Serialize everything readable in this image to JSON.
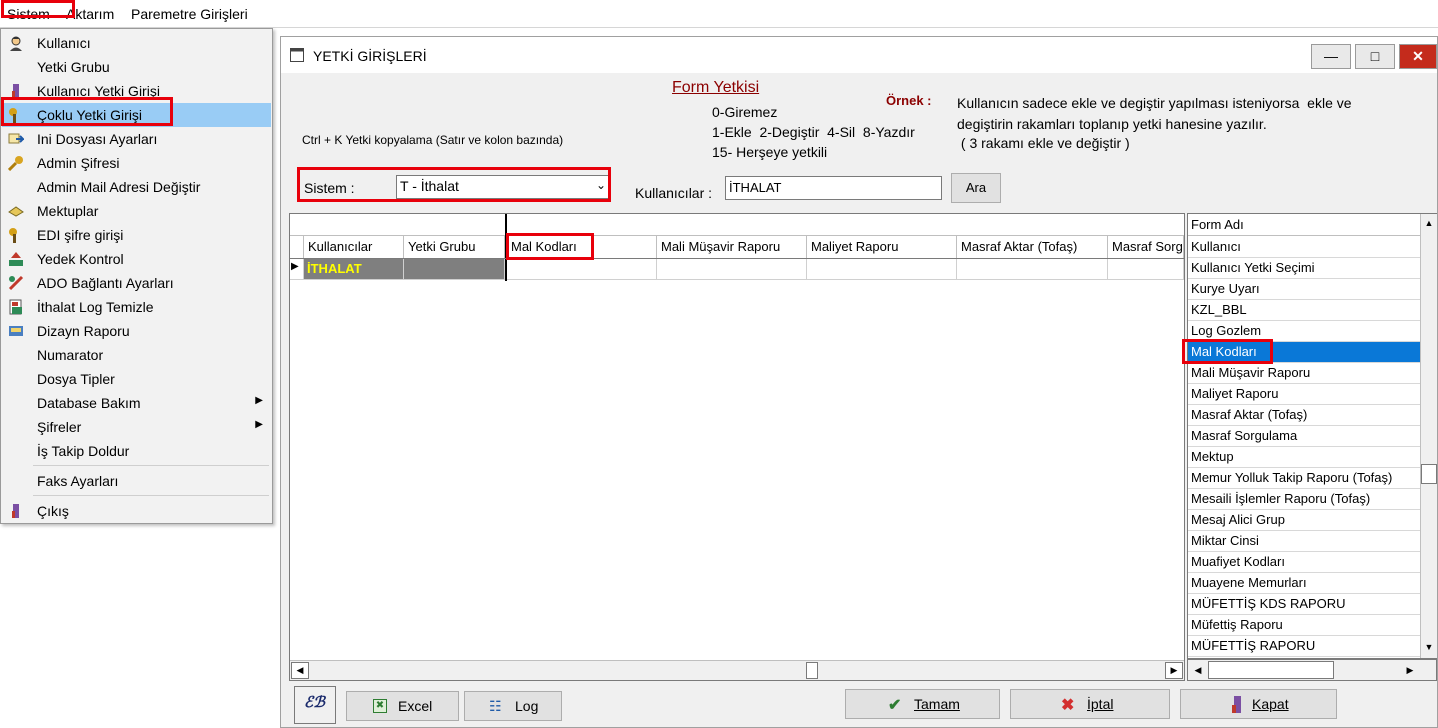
{
  "menubar": {
    "items": [
      "Sistem",
      "Aktarım",
      "Paremetre Girişleri"
    ]
  },
  "dropdown": {
    "items": [
      {
        "label": "Kullanıcı",
        "icon": "user-icon"
      },
      {
        "label": "Yetki Grubu",
        "icon": ""
      },
      {
        "label": "Kullanıcı Yetki Girişi",
        "icon": "user-key-icon"
      },
      {
        "label": "Çoklu Yetki Girişi",
        "icon": "multi-key-icon"
      },
      {
        "label": "Ini Dosyası  Ayarları",
        "icon": "ini-settings-icon"
      },
      {
        "label": "Admin Şifresi",
        "icon": "key-icon"
      },
      {
        "label": "Admin Mail Adresi Değiştir",
        "icon": ""
      },
      {
        "label": "Mektuplar",
        "icon": "letters-icon"
      },
      {
        "label": "EDI şifre girişi",
        "icon": "edi-key-icon"
      },
      {
        "label": "Yedek Kontrol",
        "icon": "backup-icon"
      },
      {
        "label": "ADO Bağlantı Ayarları",
        "icon": "connection-icon"
      },
      {
        "label": "İthalat Log Temizle",
        "icon": "log-clean-icon"
      },
      {
        "label": "Dizayn Raporu",
        "icon": "report-icon"
      },
      {
        "label": "Numarator",
        "icon": ""
      },
      {
        "label": "Dosya Tipler",
        "icon": ""
      },
      {
        "label": "Database Bakım",
        "icon": ""
      },
      {
        "label": "Şifreler",
        "icon": ""
      },
      {
        "label": "İş Takip Doldur",
        "icon": ""
      },
      {
        "label": "Faks Ayarları",
        "icon": ""
      },
      {
        "label": "Çıkış",
        "icon": "exit-icon"
      }
    ]
  },
  "window": {
    "title": "YETKİ GİRİŞLERİ",
    "form_title": "Form Yetkisi",
    "legend": [
      "0-Giremez",
      "1-Ekle  2-Degiştir  4-Sil  8-Yazdır",
      "15- Herşeye yetkili"
    ],
    "example_label": "Örnek :",
    "example_text": [
      "Kullanıcın sadece ekle ve degiştir yapılması isteniyorsa  ekle ve",
      "degiştirin rakamları toplanıp yetki hanesine yazılır.",
      " ( 3 rakamı ekle ve değiştir )"
    ],
    "copy_hint": "Ctrl + K Yetki kopyalama (Satır ve kolon bazında)",
    "sistem_label": "Sistem :",
    "sistem_value": "T - İthalat",
    "kullanicilar_label": "Kullanıcılar :",
    "kullanicilar_value": "İTHALAT",
    "ara_button": "Ara"
  },
  "grid": {
    "columns": [
      "Kullanıcılar",
      "Yetki Grubu",
      "Mal Kodları",
      "Mali Müşavir Raporu",
      "Maliyet Raporu",
      "Masraf Aktar (Tofaş)",
      "Masraf Sorg"
    ],
    "rows": [
      [
        "İTHALAT",
        "",
        "",
        "",
        "",
        "",
        ""
      ]
    ]
  },
  "form_list": {
    "header": "Form Adı",
    "items": [
      "Kullanıcı",
      "Kullanıcı Yetki Seçimi",
      "Kurye Uyarı",
      "KZL_BBL",
      "Log Gozlem",
      "Mal Kodları",
      "Mali Müşavir Raporu",
      "Maliyet Raporu",
      "Masraf Aktar (Tofaş)",
      "Masraf Sorgulama",
      "Mektup",
      "Memur Yolluk Takip Raporu (Tofaş)",
      "Mesaili İşlemler Raporu (Tofaş)",
      "Mesaj Alici Grup",
      "Miktar Cinsi",
      "Muafiyet Kodları",
      "Muayene Memurları",
      "MÜFETTİŞ KDS RAPORU",
      "Müfettiş Raporu",
      "MÜFETTİŞ RAPORU"
    ],
    "selected": "Mal Kodları"
  },
  "bottom": {
    "excel": "Excel",
    "log": "Log",
    "tamam": "Tamam",
    "iptal": "İptal",
    "kapat": "Kapat"
  },
  "colors": {
    "accent_red": "#e8000b",
    "selection_blue": "#0a78d7",
    "menu_highlight": "#99ccf5",
    "row_user_bg": "#7f7f7f",
    "row_user_text": "#ffff00",
    "heading_red": "#8b0000"
  }
}
